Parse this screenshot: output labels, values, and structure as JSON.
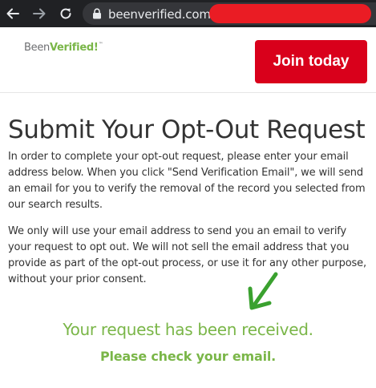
{
  "browser": {
    "url": "beenverified.com..."
  },
  "header": {
    "logo": {
      "part1": "Been",
      "part2": "Verified!",
      "mark": "™"
    },
    "join_label": "Join today"
  },
  "main": {
    "title": "Submit Your Opt-Out Request",
    "paragraph1": "In order to complete your opt-out request, please enter your email address below. When you click \"Send Verification Email\", we will send an email for you to verify the removal of the record you selected from our search results.",
    "paragraph2": "We only will use your email address to send you an email to verify your request to opt out. We will not sell the email address that you provide as part of the opt-out process, or use it for any other purpose, without your prior consent.",
    "confirmation": "Your request has been received.",
    "check_email": "Please check your email."
  },
  "colors": {
    "browser_bar": "#202124",
    "url_bar": "#35363a",
    "redaction": "#ea1c24",
    "brand_green": "#7ab648",
    "join_button": "#d9001b",
    "arrow": "#3aa12f"
  },
  "icons": [
    "back-arrow-icon",
    "forward-arrow-icon",
    "reload-icon",
    "lock-icon",
    "annotation-arrow-icon"
  ]
}
